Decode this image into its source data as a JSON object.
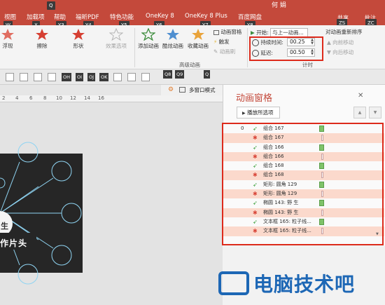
{
  "titlebar": {
    "user": "何 娟",
    "menus": [
      "视图",
      "加载项",
      "帮助",
      "福昕PDF",
      "特色功能",
      "OneKey 8",
      "OneKey 8 Plus",
      "百度网盘"
    ],
    "keytips_row1": [
      "Q"
    ],
    "keytips_row2": [
      "W",
      "X",
      "Y3",
      "Y4",
      "Y5",
      "Y6",
      "Y7",
      "Y8"
    ],
    "share": "共享",
    "share_keytip": "ZS",
    "comment": "批注",
    "comment_keytip": "ZC"
  },
  "ribbon": {
    "effects": [
      "擦除",
      "形状"
    ],
    "effects_left": "浮现",
    "effect_options": "效果选项",
    "add_animation": "添加动画",
    "cool_animation": "酷炫动画",
    "favorite_animation": "收藏动画",
    "animation_pane": "动画窗格",
    "trigger": "触发",
    "animation_painter": "动画刷",
    "group_advanced": "高级动画",
    "start_label": "开始:",
    "start_value": "与上一动画...",
    "duration_label": "持续时间:",
    "duration_value": "00.25",
    "delay_label": "延迟:",
    "delay_value": "00.50",
    "group_timing": "计时",
    "reorder_title": "对动画重新排序",
    "move_earlier": "向前移动",
    "move_later": "向后移动"
  },
  "keyrow": {
    "tips": [
      "OH",
      "OI",
      "OJ",
      "OK",
      "Q8",
      "Q9",
      "Q"
    ],
    "multi_window": "多窗口模式"
  },
  "ruler": {
    "marks": [
      "2",
      "4",
      "6",
      "8",
      "10",
      "12",
      "14",
      "16"
    ]
  },
  "slide": {
    "label_short": "生",
    "label_title": "作片头"
  },
  "pane": {
    "title": "动画窗格",
    "play_button": "播放所选项",
    "items": [
      {
        "num": "0",
        "icon": "green",
        "label": "组合 167",
        "bar": "full",
        "alt": false
      },
      {
        "num": "",
        "icon": "star",
        "label": "组合 167",
        "bar": "thin",
        "alt": true
      },
      {
        "num": "",
        "icon": "green",
        "label": "组合 166",
        "bar": "full",
        "alt": false
      },
      {
        "num": "",
        "icon": "star",
        "label": "组合 166",
        "bar": "thin",
        "alt": true
      },
      {
        "num": "",
        "icon": "green",
        "label": "组合 168",
        "bar": "full",
        "alt": false
      },
      {
        "num": "",
        "icon": "star",
        "label": "组合 168",
        "bar": "thin",
        "alt": true
      },
      {
        "num": "",
        "icon": "green",
        "label": "矩形: 圆角 129",
        "bar": "full",
        "alt": false
      },
      {
        "num": "",
        "icon": "star",
        "label": "矩形: 圆角 129",
        "bar": "thin",
        "alt": true
      },
      {
        "num": "",
        "icon": "green",
        "label": "椭圆 143: 野 生",
        "bar": "full",
        "alt": false
      },
      {
        "num": "",
        "icon": "star",
        "label": "椭圆 143: 野 生",
        "bar": "thin",
        "alt": true
      },
      {
        "num": "",
        "icon": "green",
        "label": "文本框 165: 粒子线...",
        "bar": "full",
        "alt": false
      },
      {
        "num": "",
        "icon": "star",
        "label": "文本框 165: 粒子线...",
        "bar": "thin",
        "alt": true
      }
    ]
  },
  "watermark": {
    "text": "电脑技术吧"
  },
  "colors": {
    "accent": "#c4493b",
    "highlight": "#dd2b1c",
    "watermark": "#1d67b5"
  }
}
